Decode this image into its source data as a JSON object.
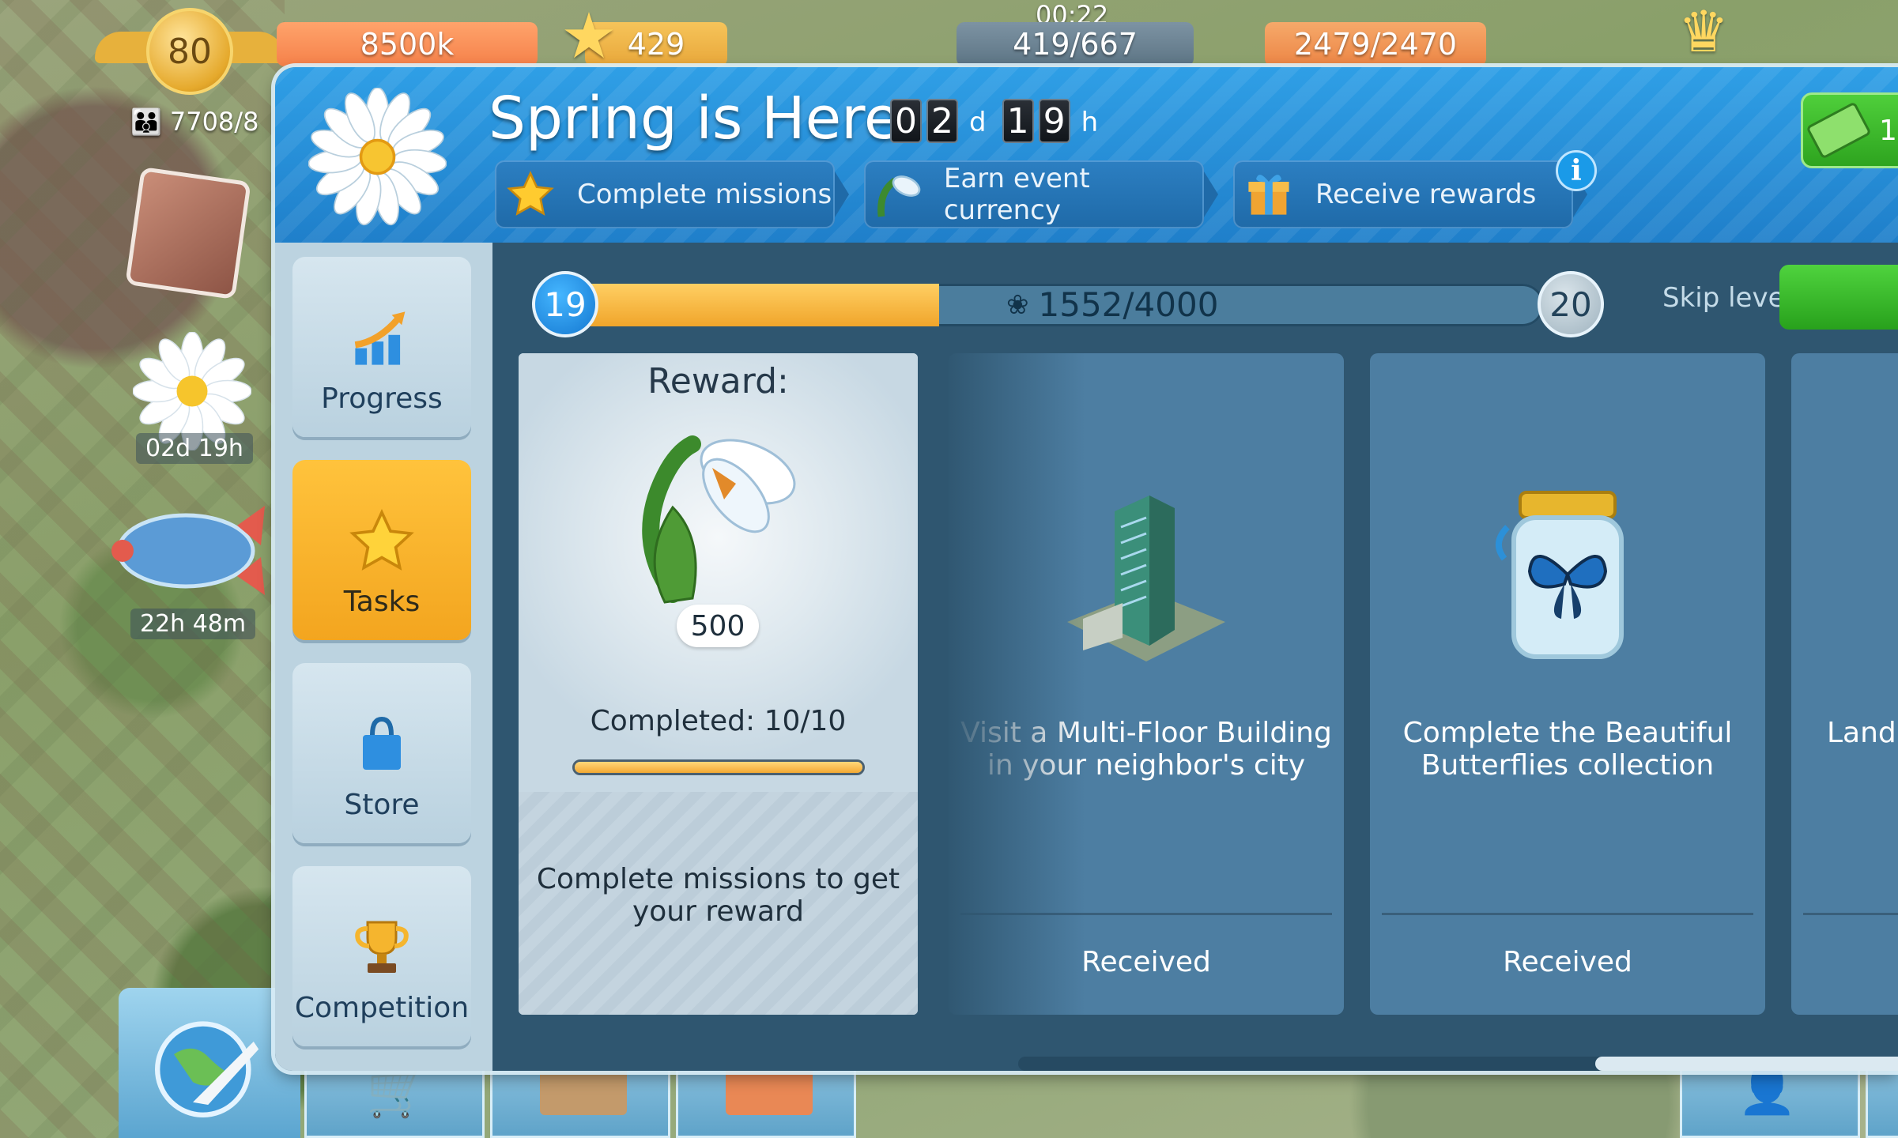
{
  "hud": {
    "level": "80",
    "coins": "8500k",
    "stars": "429",
    "timer": "00:22",
    "energy": "419/667",
    "storage": "2479/2470",
    "population": "7708/8"
  },
  "side": {
    "event_timer": "02d 19h",
    "blimp_timer": "22h 48m"
  },
  "event": {
    "title": "Spring is Here",
    "countdown": {
      "d1": "0",
      "d2": "2",
      "d_unit": "d",
      "h1": "1",
      "h2": "9",
      "h_unit": "h"
    },
    "steps": [
      {
        "label": "Complete missions",
        "icon": "star-icon"
      },
      {
        "label": "Earn event currency",
        "icon": "snowdrop-icon"
      },
      {
        "label": "Receive rewards",
        "icon": "gift-icon"
      }
    ],
    "info": "i",
    "cash_label": "1"
  },
  "nav": [
    {
      "label": "Progress",
      "icon": "progress-chart-icon"
    },
    {
      "label": "Tasks",
      "icon": "star-icon"
    },
    {
      "label": "Store",
      "icon": "shopping-bag-icon"
    },
    {
      "label": "Competition",
      "icon": "trophy-icon"
    }
  ],
  "progress": {
    "current_level": "19",
    "next_level": "20",
    "value_text": "1552/4000",
    "fraction": 0.388,
    "skip_label": "Skip level"
  },
  "reward": {
    "title": "Reward:",
    "amount": "500",
    "completed": "Completed: 10/10",
    "completed_fraction": 1.0,
    "hint": "Complete missions to get your reward"
  },
  "tasks": [
    {
      "description": "Visit a Multi-Floor Building in your neighbor's city",
      "status": "Received",
      "icon": "skyscraper-icon"
    },
    {
      "description": "Complete the Beautiful Butterflies collection",
      "status": "Received",
      "icon": "butterfly-jar-icon"
    },
    {
      "description": "Land",
      "status": "",
      "icon": ""
    }
  ],
  "colors": {
    "header": "#2f9fe6",
    "active_tab": "#f3a51f",
    "progress_fill": "#f0a52b",
    "card": "#4d7ea2"
  }
}
